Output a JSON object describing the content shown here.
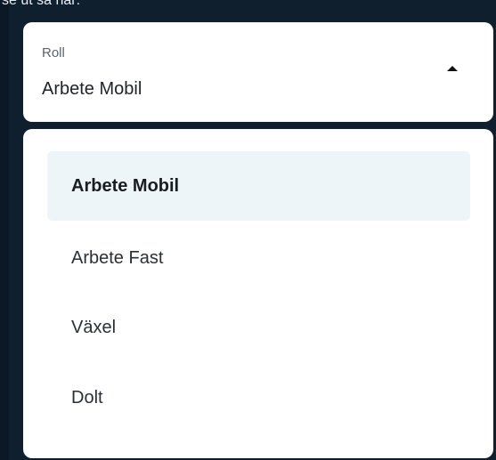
{
  "background_text": "se ut så här:",
  "select": {
    "label": "Roll",
    "value": "Arbete Mobil",
    "open_icon": "caret-up-icon"
  },
  "menu": {
    "selected_index": 0,
    "items": [
      {
        "label": "Arbete Mobil"
      },
      {
        "label": "Arbete Fast"
      },
      {
        "label": "Växel"
      },
      {
        "label": "Dolt"
      }
    ]
  },
  "colors": {
    "page_background": "#0f1f2e",
    "surface": "#ffffff",
    "selected_item_background": "#eef5f8"
  }
}
